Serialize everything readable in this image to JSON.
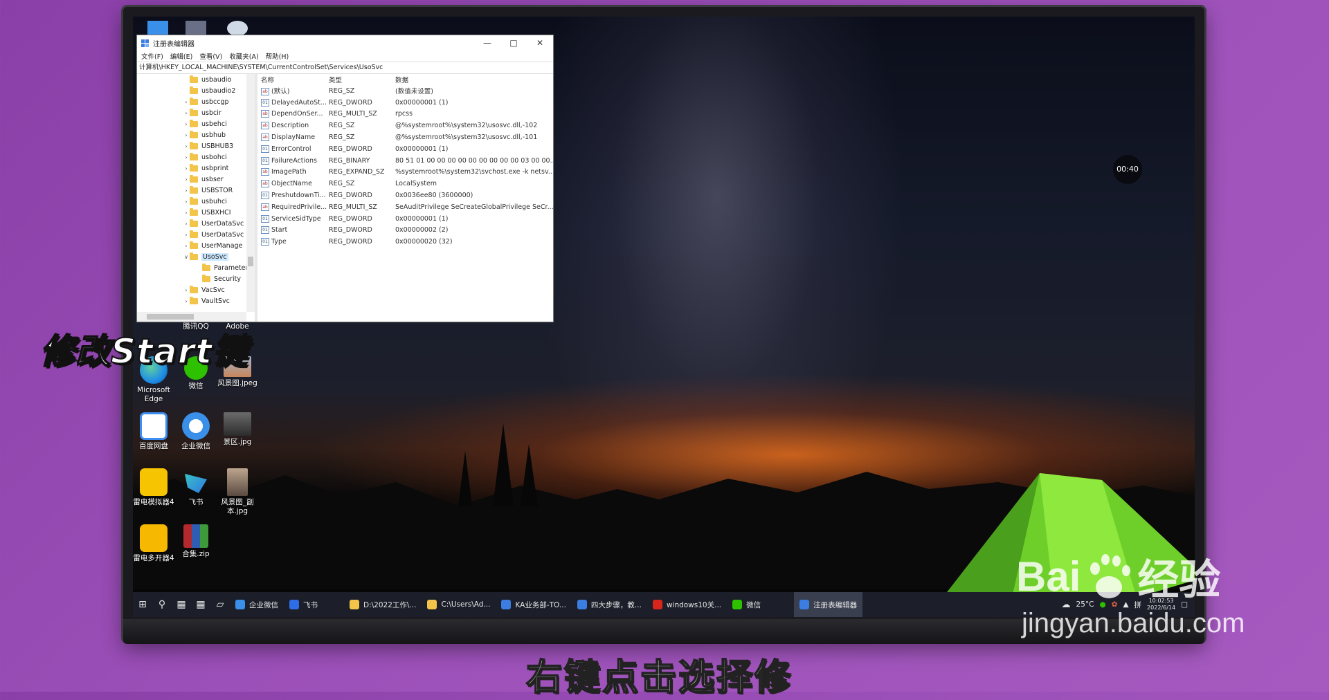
{
  "overlay": {
    "title": "修改Start键",
    "subtitle": "右键点击选择修",
    "watermark_main_1": "Bai",
    "watermark_main_2": "经验",
    "watermark_sub": "jingyan.baidu.com",
    "timer": "00:40"
  },
  "regedit": {
    "title": "注册表编辑器",
    "menu": [
      "文件(F)",
      "编辑(E)",
      "查看(V)",
      "收藏夹(A)",
      "帮助(H)"
    ],
    "path": "计算机\\HKEY_LOCAL_MACHINE\\SYSTEM\\CurrentControlSet\\Services\\UsoSvc",
    "tree": [
      {
        "label": "usbaudio",
        "arrow": ""
      },
      {
        "label": "usbaudio2",
        "arrow": ""
      },
      {
        "label": "usbccgp",
        "arrow": ">"
      },
      {
        "label": "usbcir",
        "arrow": ">"
      },
      {
        "label": "usbehci",
        "arrow": ">"
      },
      {
        "label": "usbhub",
        "arrow": ">"
      },
      {
        "label": "USBHUB3",
        "arrow": ">"
      },
      {
        "label": "usbohci",
        "arrow": ">"
      },
      {
        "label": "usbprint",
        "arrow": ">"
      },
      {
        "label": "usbser",
        "arrow": ">"
      },
      {
        "label": "USBSTOR",
        "arrow": ">"
      },
      {
        "label": "usbuhci",
        "arrow": ">"
      },
      {
        "label": "USBXHCI",
        "arrow": ">"
      },
      {
        "label": "UserDataSvc",
        "arrow": ">"
      },
      {
        "label": "UserDataSvc",
        "arrow": ">"
      },
      {
        "label": "UserManage",
        "arrow": ">"
      },
      {
        "label": "UsoSvc",
        "arrow": "v"
      },
      {
        "label": "Parameter",
        "arrow": ""
      },
      {
        "label": "Security",
        "arrow": ""
      },
      {
        "label": "VacSvc",
        "arrow": ">"
      },
      {
        "label": "VaultSvc",
        "arrow": ">"
      }
    ],
    "columns": {
      "name": "名称",
      "type": "类型",
      "data": "数据"
    },
    "rows": [
      {
        "icon": "ab",
        "name": "(默认)",
        "type": "REG_SZ",
        "data": "(数值未设置)"
      },
      {
        "icon": "bin",
        "name": "DelayedAutoSt...",
        "type": "REG_DWORD",
        "data": "0x00000001 (1)"
      },
      {
        "icon": "ab",
        "name": "DependOnSer...",
        "type": "REG_MULTI_SZ",
        "data": "rpcss"
      },
      {
        "icon": "ab",
        "name": "Description",
        "type": "REG_SZ",
        "data": "@%systemroot%\\system32\\usosvc.dll,-102"
      },
      {
        "icon": "ab",
        "name": "DisplayName",
        "type": "REG_SZ",
        "data": "@%systemroot%\\system32\\usosvc.dll,-101"
      },
      {
        "icon": "bin",
        "name": "ErrorControl",
        "type": "REG_DWORD",
        "data": "0x00000001 (1)"
      },
      {
        "icon": "bin",
        "name": "FailureActions",
        "type": "REG_BINARY",
        "data": "80 51 01 00 00 00 00 00 00 00 00 00 03 00 00..."
      },
      {
        "icon": "ab",
        "name": "ImagePath",
        "type": "REG_EXPAND_SZ",
        "data": "%systemroot%\\system32\\svchost.exe -k netsv..."
      },
      {
        "icon": "ab",
        "name": "ObjectName",
        "type": "REG_SZ",
        "data": "LocalSystem"
      },
      {
        "icon": "bin",
        "name": "PreshutdownTi...",
        "type": "REG_DWORD",
        "data": "0x0036ee80 (3600000)"
      },
      {
        "icon": "ab",
        "name": "RequiredPrivile...",
        "type": "REG_MULTI_SZ",
        "data": "SeAuditPrivilege SeCreateGlobalPrivilege SeCr..."
      },
      {
        "icon": "bin",
        "name": "ServiceSidType",
        "type": "REG_DWORD",
        "data": "0x00000001 (1)"
      },
      {
        "icon": "bin",
        "name": "Start",
        "type": "REG_DWORD",
        "data": "0x00000002 (2)"
      },
      {
        "icon": "bin",
        "name": "Type",
        "type": "REG_DWORD",
        "data": "0x00000020 (32)"
      }
    ]
  },
  "desktop": {
    "partial_labels": [
      "腾讯QQ",
      "Adobe"
    ],
    "icons": [
      {
        "label": "Microsoft Edge",
        "color": "#1f8de6"
      },
      {
        "label": "微信",
        "color": "#2dc100"
      },
      {
        "label": "风景图.jpeg",
        "color": "#7a93b0"
      },
      {
        "label": "百度网盘",
        "color": "#3d8ef0"
      },
      {
        "label": "企业微信",
        "color": "#3a8fe8"
      },
      {
        "label": "景区.jpg",
        "color": "#5c5c5c"
      },
      {
        "label": "雷电模拟器4",
        "color": "#f6c400"
      },
      {
        "label": "飞书",
        "color": "#2e6de6"
      },
      {
        "label": "风景图_副本.jpg",
        "color": "#8a7a70"
      },
      {
        "label": "雷电多开器4",
        "color": "#f6b800"
      },
      {
        "label": "合集.zip",
        "color": "#b3292e"
      }
    ]
  },
  "taskbar": {
    "apps": [
      {
        "label": "企业微信",
        "color": "#3a8fe8"
      },
      {
        "label": "飞书",
        "color": "#2e6de6"
      },
      {
        "label": "D:\\2022工作\\...",
        "color": "#f3c44a"
      },
      {
        "label": "C:\\Users\\Ad...",
        "color": "#f3c44a"
      },
      {
        "label": "KA业务部-TO...",
        "color": "#3b7de0"
      },
      {
        "label": "四大步骤，教...",
        "color": "#3b7de0"
      },
      {
        "label": "windows10关...",
        "color": "#d9261c"
      },
      {
        "label": "微信",
        "color": "#2dc100"
      },
      {
        "label": "注册表编辑器",
        "color": "#3b7de0"
      }
    ],
    "weather": "25°C",
    "time": "10:02:53",
    "date": "2022/6/14",
    "ime": "拼"
  }
}
